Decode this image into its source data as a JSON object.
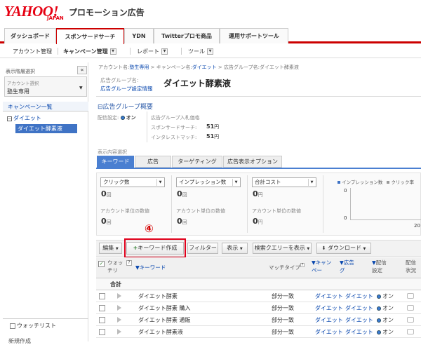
{
  "header": {
    "logo": "YAHOO!",
    "logo_sub": "JAPAN",
    "brand": "プロモーション広告"
  },
  "tabs": [
    "ダッシュボード",
    "スポンサードサーチ",
    "YDN",
    "Twitterプロモ商品",
    "運用サポートツール"
  ],
  "subnav": {
    "account": "アカウント管理",
    "campaign": "キャンペーン管理",
    "report": "レポート",
    "tools": "ツール"
  },
  "sidebar": {
    "title": "表示階層選択",
    "collapse": "«",
    "account_label": "アカウント選択",
    "account_value": "塾生専用",
    "campaign_list": "キャンペーン一覧",
    "campaign_name": "ダイエット",
    "adgroup_name": "ダイエット酵素液",
    "watchlist": "ウォッチリスト",
    "bottom": "新規作成"
  },
  "breadcrumb": {
    "account_prefix": "アカウント名:",
    "account": "塾生専用",
    "sep": ">",
    "campaign_prefix": "キャンペーン名:",
    "campaign": "ダイエット",
    "adgroup_prefix": "広告グループ名:",
    "adgroup": "ダイエット酵素液"
  },
  "adgroup": {
    "label": "広告グループ名:",
    "settings_link": "広告グループ設定情報",
    "name": "ダイエット酵素液"
  },
  "summary": {
    "title": "広告グループ概要",
    "toggle": "⊟",
    "delivery_label": "配信設定:",
    "delivery_value": "オン",
    "bid_label": "広告グループ入札価格",
    "sponsored_label": "スポンサードサーチ:",
    "sponsored_value": "51",
    "interest_label": "インタレストマッチ:",
    "interest_value": "51",
    "unit": "円"
  },
  "view": {
    "label": "表示内容選択",
    "tabs": [
      "キーワード",
      "広告",
      "ターゲティング",
      "広告表示オプション"
    ]
  },
  "metrics": [
    {
      "select": "クリック数",
      "value": "0",
      "unit": "回",
      "avg_label": "アカウント単位の数値",
      "avg": "0",
      "avg_unit": "回"
    },
    {
      "select": "インプレッション数",
      "value": "0",
      "unit": "回",
      "avg_label": "アカウント単位の数値",
      "avg": "0",
      "avg_unit": "回"
    },
    {
      "select": "合計コスト",
      "value": "0",
      "unit": "円",
      "avg_label": "アカウント単位の数値",
      "avg": "0",
      "avg_unit": "円"
    }
  ],
  "chart": {
    "legend1": "インプレッション数",
    "legend2": "クリック率",
    "y0": "0",
    "y1": "0",
    "xlabel": "20"
  },
  "step": "④",
  "toolbar": {
    "edit": "編集",
    "create": "キーワード作成",
    "filter": "フィルター",
    "display": "表示",
    "query": "検索クエリーを表示",
    "download": "ダウンロード"
  },
  "columns": {
    "watch": "ウォッチリ",
    "keyword": "キーワード",
    "match": "マッチタイプ",
    "campaign": "キャンペー",
    "adgroup": "広告グ",
    "delivery": "配信設定",
    "status": "配信状況"
  },
  "total": "合計",
  "rows": [
    {
      "keyword": "ダイエット酵素",
      "match": "部分一致",
      "campaign": "ダイエット",
      "adgroup": "ダイエット",
      "delivery": "オン"
    },
    {
      "keyword": "ダイエット酵素 購入",
      "match": "部分一致",
      "campaign": "ダイエット",
      "adgroup": "ダイエット",
      "delivery": "オン"
    },
    {
      "keyword": "ダイエット酵素 通販",
      "match": "部分一致",
      "campaign": "ダイエット",
      "adgroup": "ダイエット",
      "delivery": "オン"
    },
    {
      "keyword": "ダイエット酵素液",
      "match": "部分一致",
      "campaign": "ダイエット",
      "adgroup": "ダイエット",
      "delivery": "オン"
    }
  ]
}
